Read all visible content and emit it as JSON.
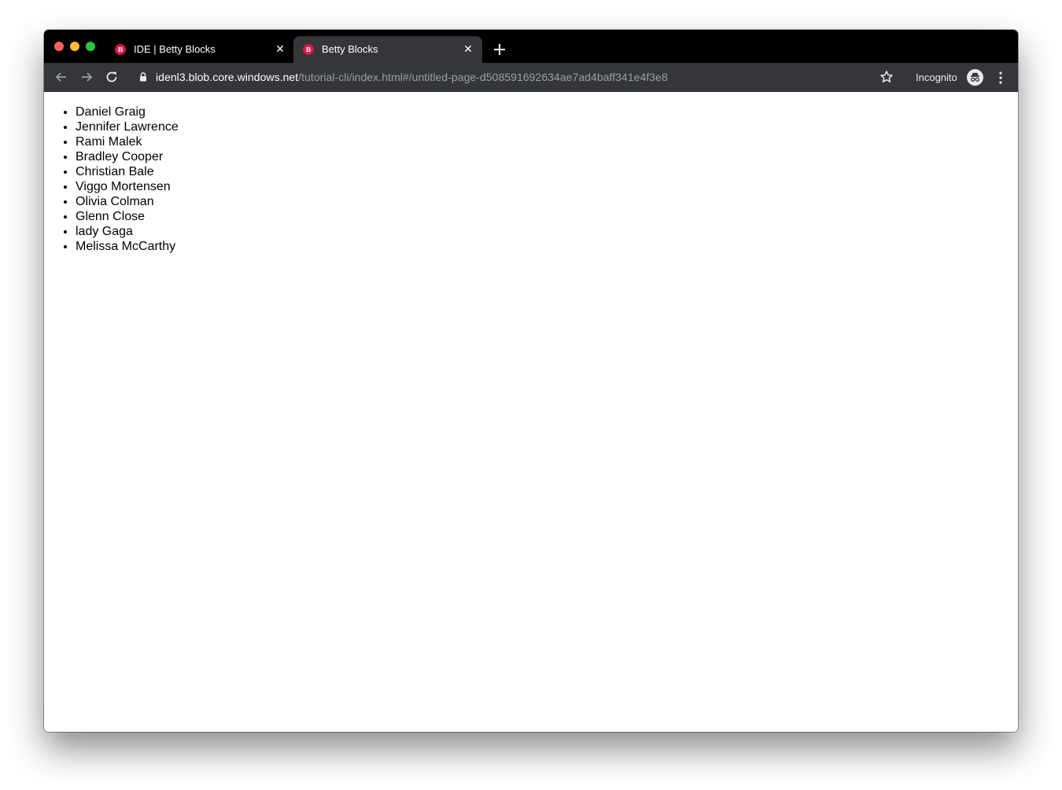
{
  "browser": {
    "tabs": [
      {
        "title": "IDE | Betty Blocks",
        "favicon": "betty-blocks-icon",
        "active": false
      },
      {
        "title": "Betty Blocks",
        "favicon": "betty-blocks-icon",
        "active": true
      }
    ],
    "favicon_letter": "B",
    "close_glyph": "✕",
    "address": {
      "host": "idenl3.blob.core.windows.net",
      "path": "/tutorial-cli/index.html#/untitled-page-d508591692634ae7ad4baff341e4f3e8"
    },
    "incognito_label": "Incognito",
    "colors": {
      "tabstrip": "#000000",
      "toolbar": "#35363a",
      "favicon": "#e0144c"
    }
  },
  "page": {
    "items": [
      "Daniel Graig",
      "Jennifer Lawrence",
      "Rami Malek",
      "Bradley Cooper",
      "Christian Bale",
      "Viggo Mortensen",
      "Olivia Colman",
      "Glenn Close",
      "lady Gaga",
      "Melissa McCarthy"
    ]
  }
}
